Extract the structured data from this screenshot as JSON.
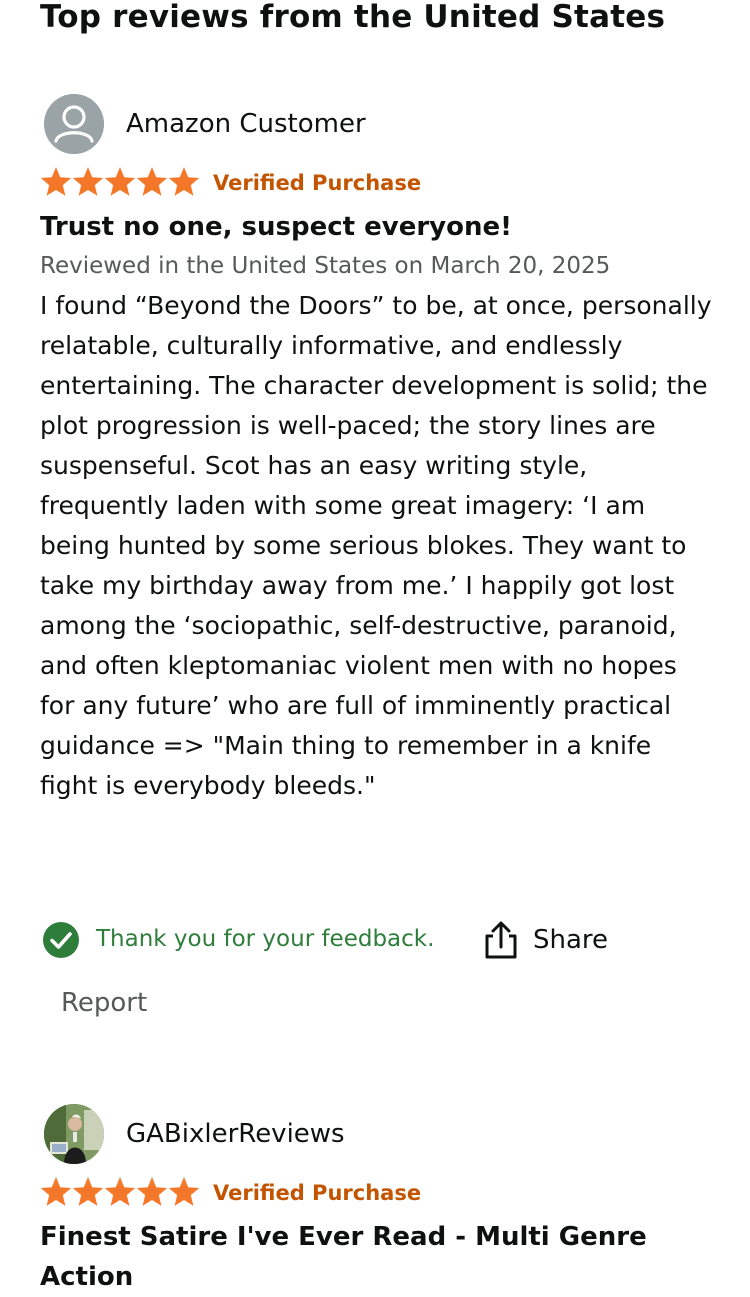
{
  "section": {
    "title": "Top reviews from the United States"
  },
  "reviews": [
    {
      "reviewer_name": "Amazon Customer",
      "avatar": "default-profile-icon",
      "rating": 5,
      "rating_max": 5,
      "verified": "Verified Purchase",
      "title": "Trust no one, suspect everyone!",
      "date_line": "Reviewed in the United States on March 20, 2025",
      "body": "I found “Beyond the Doors” to be, at once, personally relatable, culturally informative, and endlessly entertaining. The character development is solid; the plot progression is well-paced; the story lines are suspenseful. Scot has an easy writing style, frequently laden with some great imagery: ‘I am being hunted by some serious blokes. They want to take my birthday away from me.’ I happily got lost among the ‘sociopathic, self-destructive, paranoid, and often kleptomaniac violent men with no hopes for any future’ who are full of imminently practical guidance => \"Main thing to remember in a knife fight is everybody bleeds.\"",
      "feedback_text": "Thank you for your feedback.",
      "share_label": "Share",
      "report_label": "Report"
    },
    {
      "reviewer_name": "GABixlerReviews",
      "avatar": "reviewer-photo",
      "rating": 5,
      "rating_max": 5,
      "verified": "Verified Purchase",
      "title": "Finest Satire I've Ever Read - Multi Genre Action"
    }
  ],
  "colors": {
    "star": "#f5782a",
    "verified": "#c45500",
    "feedback_green": "#2e7d3b",
    "muted_text": "#565959"
  },
  "icons": [
    "default-profile-icon",
    "star-icon",
    "check-circle-icon",
    "share-icon"
  ]
}
